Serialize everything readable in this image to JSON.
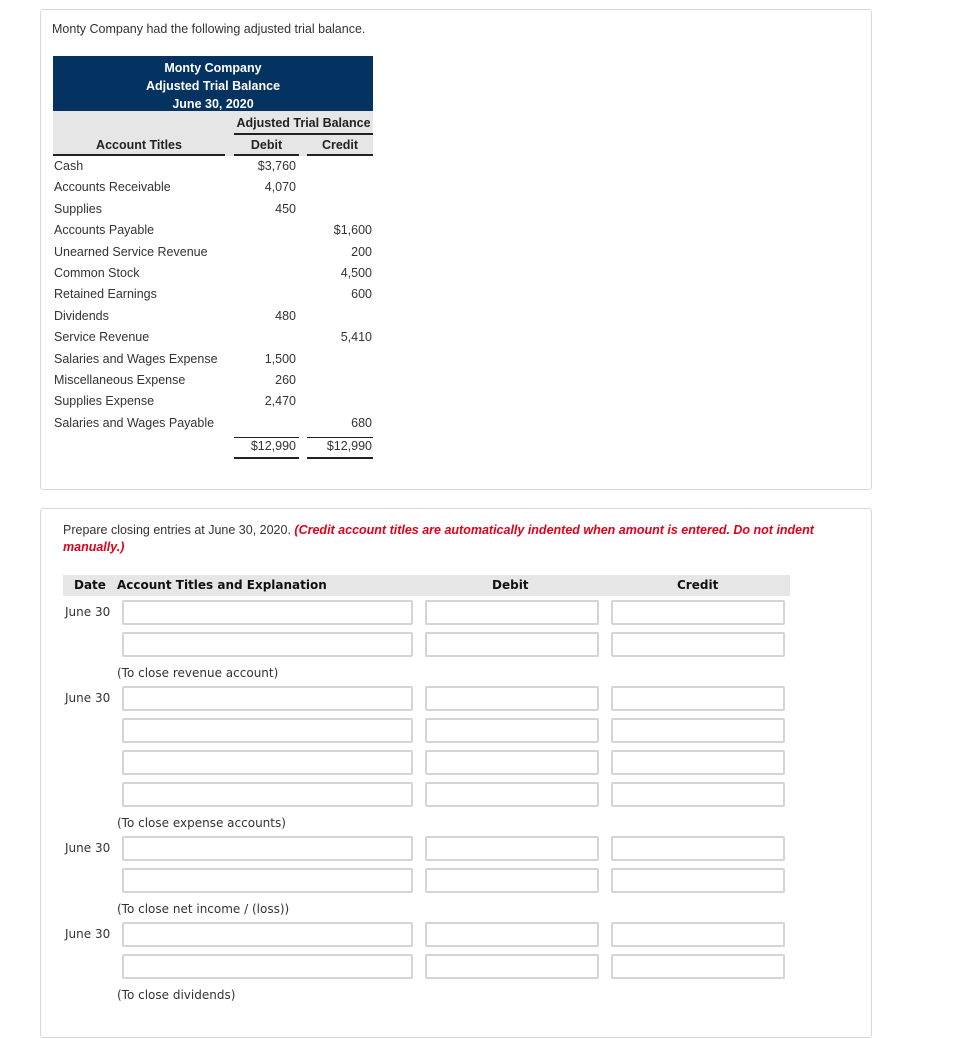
{
  "intro": "Monty Company had the following adjusted trial balance.",
  "trial_balance": {
    "company": "Monty Company",
    "title": "Adjusted Trial Balance",
    "date": "June 30, 2020",
    "group_header": "Adjusted Trial Balance",
    "col_account": "Account Titles",
    "col_debit": "Debit",
    "col_credit": "Credit",
    "rows": [
      {
        "account": "Cash",
        "debit": "$3,760",
        "credit": ""
      },
      {
        "account": "Accounts Receivable",
        "debit": "4,070",
        "credit": ""
      },
      {
        "account": "Supplies",
        "debit": "450",
        "credit": ""
      },
      {
        "account": "Accounts Payable",
        "debit": "",
        "credit": "$1,600"
      },
      {
        "account": "Unearned Service Revenue",
        "debit": "",
        "credit": "200"
      },
      {
        "account": "Common Stock",
        "debit": "",
        "credit": "4,500"
      },
      {
        "account": "Retained Earnings",
        "debit": "",
        "credit": "600"
      },
      {
        "account": "Dividends",
        "debit": "480",
        "credit": ""
      },
      {
        "account": "Service Revenue",
        "debit": "",
        "credit": "5,410"
      },
      {
        "account": "Salaries and Wages Expense",
        "debit": "1,500",
        "credit": ""
      },
      {
        "account": "Miscellaneous Expense",
        "debit": "260",
        "credit": ""
      },
      {
        "account": "Supplies Expense",
        "debit": "2,470",
        "credit": ""
      },
      {
        "account": "Salaries and Wages Payable",
        "debit": "",
        "credit": "680"
      }
    ],
    "total_debit": "$12,990",
    "total_credit": "$12,990"
  },
  "question": {
    "instruction": "Prepare closing entries at June 30, 2020.",
    "note": "(Credit account titles are automatically indented when amount is entered. Do not indent manually.)"
  },
  "journal": {
    "headers": {
      "date": "Date",
      "account": "Account Titles and Explanation",
      "debit": "Debit",
      "credit": "Credit"
    },
    "entries": [
      {
        "date": "June 30",
        "explanation": "(To close revenue account)",
        "lines": [
          {
            "account": "",
            "debit": "",
            "credit": ""
          },
          {
            "account": "",
            "debit": "",
            "credit": ""
          }
        ]
      },
      {
        "date": "June 30",
        "explanation": "(To close expense accounts)",
        "lines": [
          {
            "account": "",
            "debit": "",
            "credit": ""
          },
          {
            "account": "",
            "debit": "",
            "credit": ""
          },
          {
            "account": "",
            "debit": "",
            "credit": ""
          },
          {
            "account": "",
            "debit": "",
            "credit": ""
          }
        ]
      },
      {
        "date": "June 30",
        "explanation": "(To close net income / (loss))",
        "lines": [
          {
            "account": "",
            "debit": "",
            "credit": ""
          },
          {
            "account": "",
            "debit": "",
            "credit": ""
          }
        ]
      },
      {
        "date": "June 30",
        "explanation": "(To close dividends)",
        "lines": [
          {
            "account": "",
            "debit": "",
            "credit": ""
          },
          {
            "account": "",
            "debit": "",
            "credit": ""
          }
        ]
      }
    ]
  },
  "colors": {
    "header_navy": "#043361",
    "note_red": "#e0001b",
    "header_gray": "#e6e6e6"
  }
}
